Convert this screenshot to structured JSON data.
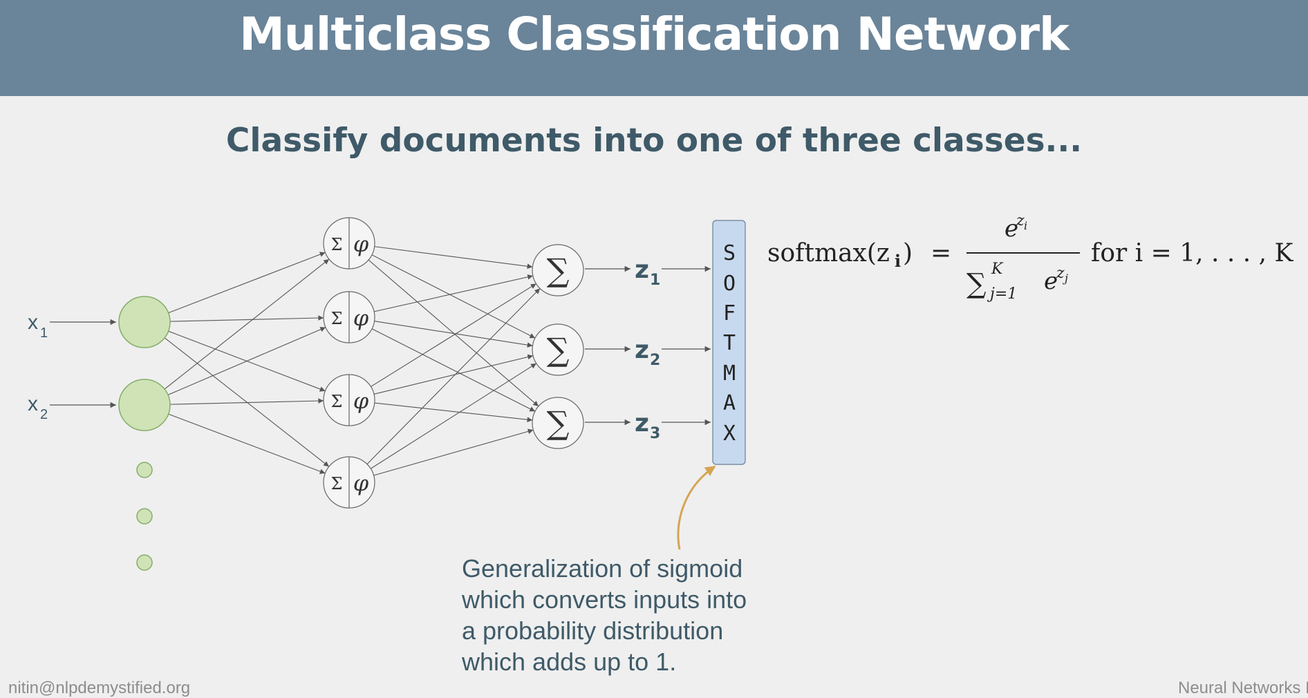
{
  "slide": {
    "title": "Multiclass Classification Network",
    "subtitle": "Classify documents into one of three classes...",
    "footer_left": "nitin@nlpdemystified.org",
    "footer_right": "Neural Networks I"
  },
  "diagram": {
    "inputs": [
      {
        "base": "x",
        "sub": "1"
      },
      {
        "base": "x",
        "sub": "2"
      }
    ],
    "hidden_node": {
      "sum": "Σ",
      "activation": "φ"
    },
    "output_node": {
      "sum": "∑"
    },
    "outputs": [
      {
        "base": "z",
        "sub": "1"
      },
      {
        "base": "z",
        "sub": "2"
      },
      {
        "base": "z",
        "sub": "3"
      }
    ],
    "softmax_letters": [
      "S",
      "O",
      "F",
      "T",
      "M",
      "A",
      "X"
    ],
    "formula": {
      "lhs": "softmax(z",
      "lhs_sub": "i",
      "lhs_close": ")",
      "equals": "=",
      "numerator": "e",
      "numerator_sup": "z",
      "numerator_sup_sub": "i",
      "denominator_sum": "∑",
      "denominator_upper": "K",
      "denominator_lower": "j=1",
      "denominator_e": "e",
      "denominator_sup": "z",
      "denominator_sup_sub": "j",
      "range": "for i = 1, . . . , K"
    },
    "annotation_lines": [
      "Generalization of sigmoid",
      "which converts inputs into",
      "a probability distribution",
      "which adds up to 1."
    ],
    "colors": {
      "header_bg": "#6a8499",
      "text_dark": "#3f5a68",
      "input_fill": "#cfe3b6",
      "input_stroke": "#85ad6a",
      "softmax_fill": "#c7d9ee",
      "arrow_annotation": "#d4a553"
    }
  }
}
